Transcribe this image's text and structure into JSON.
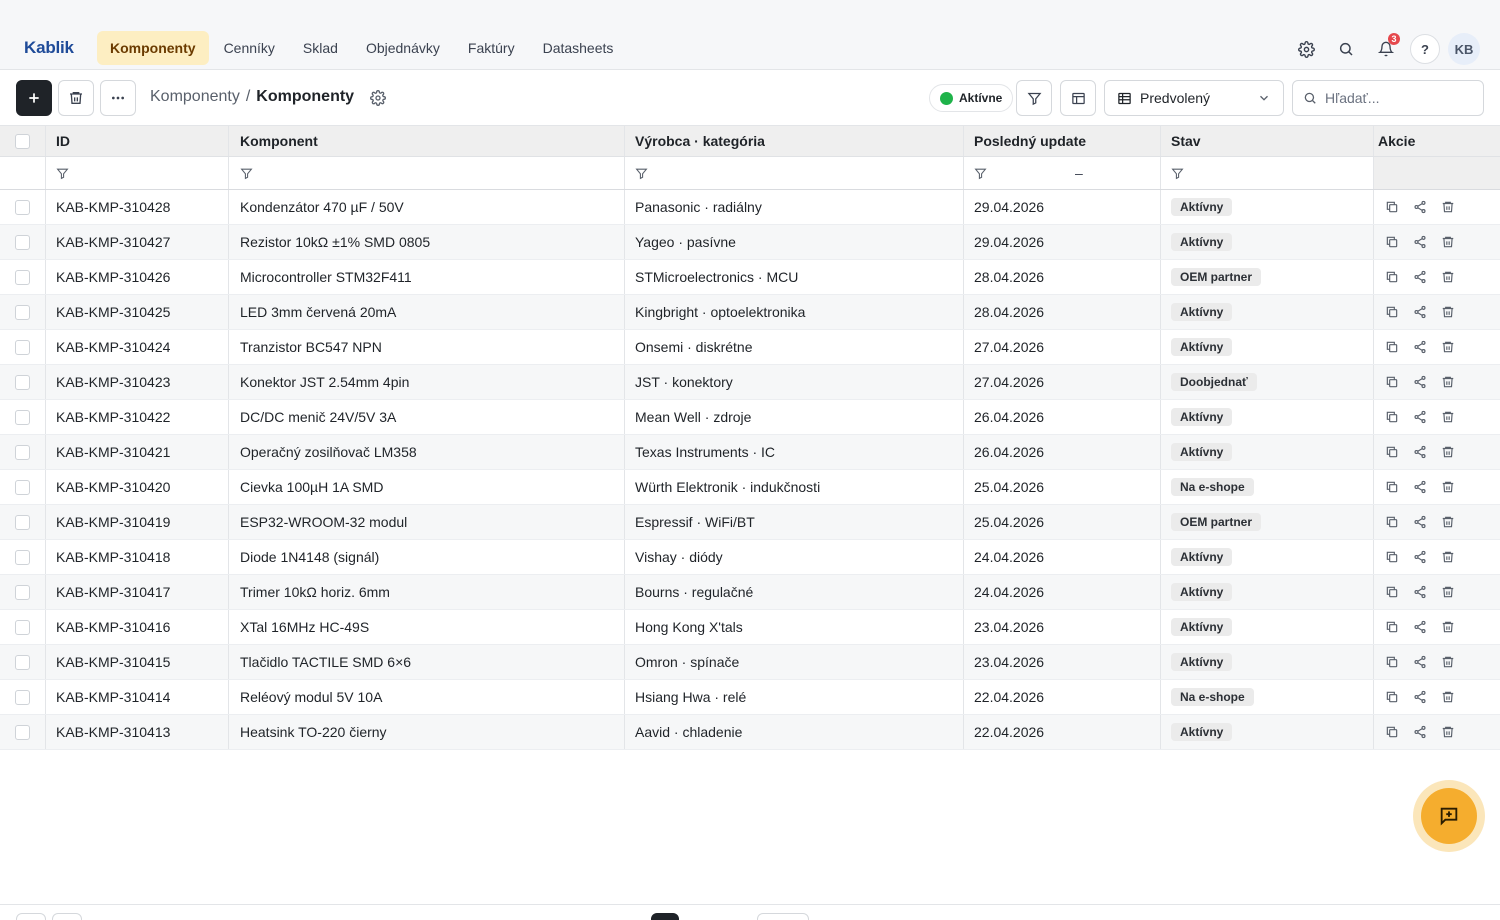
{
  "app": {
    "brand": "Kablik"
  },
  "nav": {
    "tabs": [
      {
        "label": "Komponenty",
        "active": true
      },
      {
        "label": "Cenníky"
      },
      {
        "label": "Sklad"
      },
      {
        "label": "Objednávky"
      },
      {
        "label": "Faktúry"
      },
      {
        "label": "Datasheets"
      }
    ],
    "notifications_count": "3",
    "help_label": "?",
    "avatar_initials": "KB"
  },
  "toolbar": {
    "breadcrumb_parent": "Komponenty",
    "breadcrumb_sep": "/",
    "breadcrumb_current": "Komponenty",
    "status_filter": "Aktívne",
    "view_name": "Predvolený",
    "search_placeholder": "Hľadať..."
  },
  "table": {
    "columns": [
      "ID",
      "Komponent",
      "Výrobca · kategória",
      "Posledný update",
      "Stav",
      "Akcie"
    ],
    "date_range_sep": "–",
    "rows": [
      {
        "id": "KAB-KMP-310428",
        "name": "Kondenzátor 470 µF / 50V",
        "maker": "Panasonic · radiálny",
        "date": "29.04.2026",
        "status": "Aktívny"
      },
      {
        "id": "KAB-KMP-310427",
        "name": "Rezistor 10kΩ ±1% SMD 0805",
        "maker": "Yageo · pasívne",
        "date": "29.04.2026",
        "status": "Aktívny"
      },
      {
        "id": "KAB-KMP-310426",
        "name": "Microcontroller STM32F411",
        "maker": "STMicroelectronics · MCU",
        "date": "28.04.2026",
        "status": "OEM partner"
      },
      {
        "id": "KAB-KMP-310425",
        "name": "LED 3mm červená 20mA",
        "maker": "Kingbright · optoelektronika",
        "date": "28.04.2026",
        "status": "Aktívny"
      },
      {
        "id": "KAB-KMP-310424",
        "name": "Tranzistor BC547 NPN",
        "maker": "Onsemi · diskrétne",
        "date": "27.04.2026",
        "status": "Aktívny"
      },
      {
        "id": "KAB-KMP-310423",
        "name": "Konektor JST 2.54mm 4pin",
        "maker": "JST · konektory",
        "date": "27.04.2026",
        "status": "Doobjednať"
      },
      {
        "id": "KAB-KMP-310422",
        "name": "DC/DC menič 24V/5V 3A",
        "maker": "Mean Well · zdroje",
        "date": "26.04.2026",
        "status": "Aktívny"
      },
      {
        "id": "KAB-KMP-310421",
        "name": "Operačný zosilňovač LM358",
        "maker": "Texas Instruments · IC",
        "date": "26.04.2026",
        "status": "Aktívny"
      },
      {
        "id": "KAB-KMP-310420",
        "name": "Cievka 100µH 1A SMD",
        "maker": "Würth Elektronik · indukčnosti",
        "date": "25.04.2026",
        "status": "Na e-shope"
      },
      {
        "id": "KAB-KMP-310419",
        "name": "ESP32-WROOM-32 modul",
        "maker": "Espressif · WiFi/BT",
        "date": "25.04.2026",
        "status": "OEM partner"
      },
      {
        "id": "KAB-KMP-310418",
        "name": "Diode 1N4148 (signál)",
        "maker": "Vishay · diódy",
        "date": "24.04.2026",
        "status": "Aktívny"
      },
      {
        "id": "KAB-KMP-310417",
        "name": "Trimer 10kΩ horiz. 6mm",
        "maker": "Bourns · regulačné",
        "date": "24.04.2026",
        "status": "Aktívny"
      },
      {
        "id": "KAB-KMP-310416",
        "name": "XTal 16MHz HC-49S",
        "maker": "Hong Kong X'tals",
        "date": "23.04.2026",
        "status": "Aktívny"
      },
      {
        "id": "KAB-KMP-310415",
        "name": "Tlačidlo TACTILE SMD 6×6",
        "maker": "Omron · spínače",
        "date": "23.04.2026",
        "status": "Aktívny"
      },
      {
        "id": "KAB-KMP-310414",
        "name": "Reléový modul 5V 10A",
        "maker": "Hsiang Hwa · relé",
        "date": "22.04.2026",
        "status": "Na e-shope"
      },
      {
        "id": "KAB-KMP-310413",
        "name": "Heatsink TO-220 čierny",
        "maker": "Aavid · chladenie",
        "date": "22.04.2026",
        "status": "Aktívny"
      }
    ]
  },
  "colors": {
    "accent": "#f5ad2e",
    "active_tab_bg": "#fdeec2",
    "brand": "#1f4b99",
    "status_dot": "#1fb34a",
    "badge": "#e5484d"
  },
  "icons": [
    "gear-icon",
    "search-icon",
    "bell-icon",
    "plus-icon",
    "trash-icon",
    "more-icon",
    "filter-icon",
    "columns-icon",
    "table-icon",
    "chevron-down-icon",
    "copy-icon",
    "share-icon",
    "chat-plus-icon"
  ]
}
